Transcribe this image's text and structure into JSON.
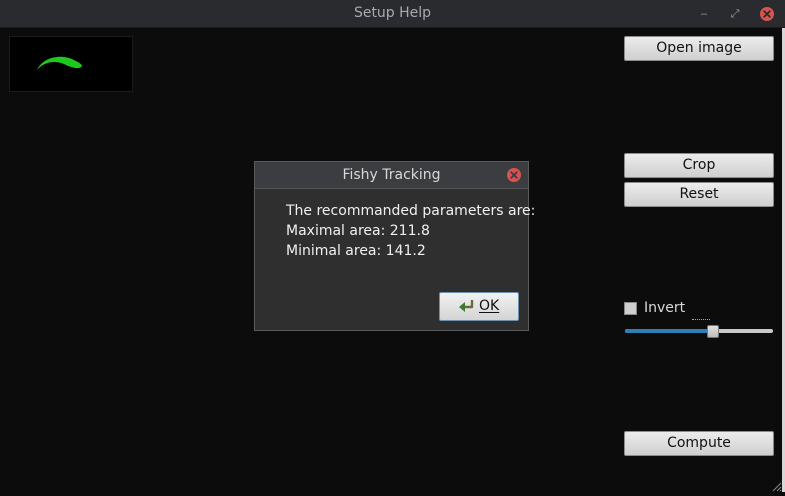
{
  "window": {
    "title": "Setup Help",
    "minimize_glyph": "‒",
    "maximize_glyph": "⤢"
  },
  "sidebar": {
    "open_image_label": "Open image",
    "crop_label": "Crop",
    "reset_label": "Reset",
    "invert_label": "Invert",
    "invert_checked": false,
    "threshold_fraction": 0.6,
    "compute_label": "Compute"
  },
  "dialog": {
    "title": "Fishy Tracking",
    "lines": [
      "The recommanded parameters are:",
      "Maximal area: 211.8",
      "Minimal area: 141.2"
    ],
    "ok_label": "OK"
  },
  "colors": {
    "slider_fill": "#2f7fb6",
    "close_red": "#d9534f",
    "fish_green": "#1ec81e"
  },
  "icons": [
    "minimize-icon",
    "maximize-icon",
    "close-icon",
    "ok-check-icon"
  ]
}
